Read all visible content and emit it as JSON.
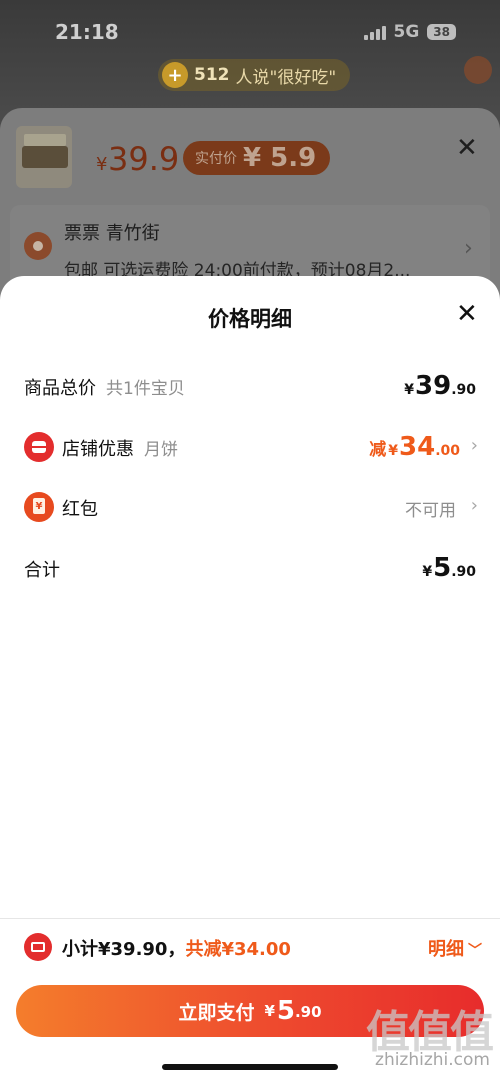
{
  "status_bar": {
    "time": "21:18",
    "network": "5G",
    "battery": "38"
  },
  "praise": {
    "count": "512",
    "text": "人说\"很好吃\""
  },
  "product": {
    "price_yen": "¥",
    "price": "39.9",
    "pay_label": "实付价",
    "pay_value": "¥ 5.9"
  },
  "address": {
    "name": "票票 青竹街",
    "detail": "包邮 可选运费险 24:00前付款，预计08月2..."
  },
  "sheet": {
    "title": "价格明细",
    "rows": [
      {
        "label": "商品总价",
        "sub": "共1件宝贝",
        "yen": "¥",
        "int": "39",
        "dec": ".90"
      },
      {
        "label": "店铺优惠",
        "sub": "月饼",
        "prefix": "减",
        "yen": "¥",
        "int": "34",
        "dec": ".00"
      },
      {
        "label": "红包",
        "value": "不可用"
      },
      {
        "label": "合计",
        "yen": "¥",
        "int": "5",
        "dec": ".90"
      }
    ]
  },
  "summary": {
    "subtotal": "小计¥39.90，",
    "reduced": "共减¥34.00",
    "toggle": "明细"
  },
  "pay_button": {
    "label": "立即支付",
    "yen": "¥",
    "int": "5",
    "dec": ".90"
  },
  "watermark": {
    "glyphs": "值值值",
    "url": "zhizhizhi.com"
  },
  "colors": {
    "accent": "#ef5a1a",
    "danger": "#e32d2d",
    "button_start": "#f47d2c",
    "button_end": "#e72c2c"
  }
}
